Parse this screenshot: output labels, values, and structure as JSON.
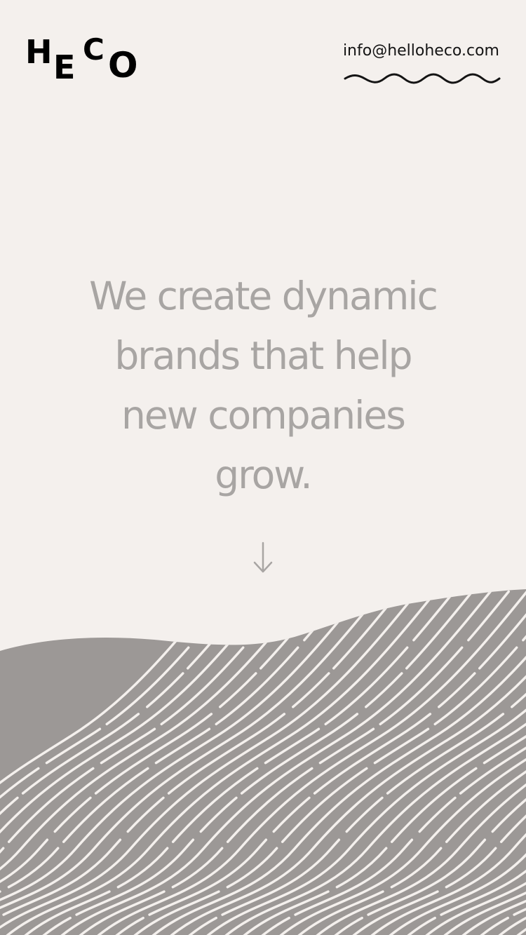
{
  "header": {
    "logo": {
      "letters": [
        "H",
        "E",
        "C",
        "O"
      ]
    },
    "email": "info@helloheco.com"
  },
  "hero": {
    "lines": [
      "We create dynamic",
      "brands that help",
      "new companies",
      "grow."
    ]
  },
  "scroll_arrow": {
    "icon": "arrow-down-icon",
    "glyph": "↓"
  },
  "colors": {
    "background": "#f4f0ed",
    "logo": "#000000",
    "email": "#141414",
    "hero_text": "#a8a5a3",
    "landscape_fill": "#9c9896",
    "landscape_lines": "#f4f0ed"
  }
}
